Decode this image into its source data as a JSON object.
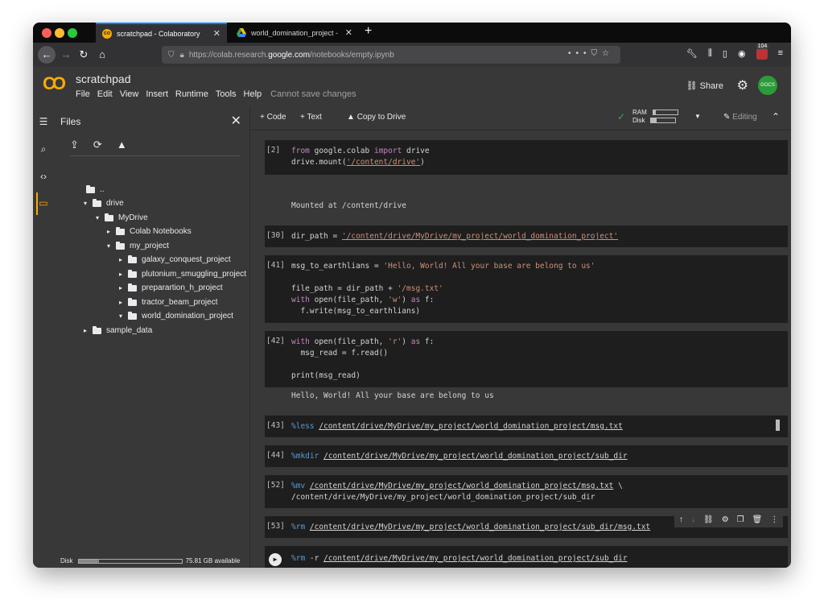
{
  "browser": {
    "tabs": [
      {
        "label": "scratchpad - Colaboratory",
        "active": true
      },
      {
        "label": "world_domination_project - Go",
        "active": false
      }
    ],
    "url_prefix": "https://colab.research.",
    "url_host": "google.com",
    "url_path": "/notebooks/empty.ipynb",
    "extension_badge": "104"
  },
  "header": {
    "logo": "CO",
    "title": "scratchpad",
    "menu": [
      "File",
      "Edit",
      "View",
      "Insert",
      "Runtime",
      "Tools",
      "Help"
    ],
    "note": "Cannot save changes",
    "share": "Share",
    "avatar": "GOCS"
  },
  "files_panel": {
    "title": "Files",
    "tree": [
      {
        "label": "..",
        "depth": 0,
        "type": "up"
      },
      {
        "label": "drive",
        "depth": 0,
        "type": "folder",
        "expanded": true
      },
      {
        "label": "MyDrive",
        "depth": 1,
        "type": "folder",
        "expanded": true
      },
      {
        "label": "Colab Notebooks",
        "depth": 2,
        "type": "folder",
        "expanded": false
      },
      {
        "label": "my_project",
        "depth": 2,
        "type": "folder",
        "expanded": true
      },
      {
        "label": "galaxy_conquest_project",
        "depth": 3,
        "type": "folder",
        "expanded": false
      },
      {
        "label": "plutonium_smuggling_project",
        "depth": 3,
        "type": "folder",
        "expanded": false
      },
      {
        "label": "preparartion_h_project",
        "depth": 3,
        "type": "folder",
        "expanded": false
      },
      {
        "label": "tractor_beam_project",
        "depth": 3,
        "type": "folder",
        "expanded": false
      },
      {
        "label": "world_domination_project",
        "depth": 3,
        "type": "folder",
        "expanded": true
      },
      {
        "label": "sample_data",
        "depth": 0,
        "type": "folder",
        "expanded": false,
        "top": true
      }
    ],
    "disk_label": "Disk",
    "disk_available": "75.81 GB available",
    "disk_used_fraction": 0.2
  },
  "toolbar": {
    "code": "Code",
    "text": "Text",
    "copy_to_drive": "Copy to Drive",
    "ram": "RAM",
    "disk": "Disk",
    "ram_fraction": 0.1,
    "disk_fraction": 0.25,
    "editing": "Editing"
  },
  "cells": [
    {
      "prompt": "[2]",
      "output": "Mounted at /content/drive"
    },
    {
      "prompt": "[30]"
    },
    {
      "prompt": "[41]"
    },
    {
      "prompt": "[42]",
      "output": "Hello, World! All your base are belong to us"
    },
    {
      "prompt": "[43]"
    },
    {
      "prompt": "[44]"
    },
    {
      "prompt": "[52]"
    },
    {
      "prompt": "[53]"
    },
    {
      "prompt": ""
    }
  ],
  "code_text": {
    "c2_l1_a": "from",
    "c2_l1_b": " google.colab ",
    "c2_l1_c": "import",
    "c2_l1_d": " drive",
    "c2_l2_a": "drive.mount(",
    "c2_l2_b": "'/content/drive'",
    "c2_l2_c": ")",
    "c30_a": "dir_path = ",
    "c30_b": "'/content/drive/MyDrive/my_project/world_domination_project'",
    "c41_l1_a": "msg_to_earthlians = ",
    "c41_l1_b": "'Hello, World! All your base are belong to us'",
    "c41_l3_a": "file_path = dir_path + ",
    "c41_l3_b": "'/msg.txt'",
    "c41_l4_a": "with",
    "c41_l4_b": " open(file_path, ",
    "c41_l4_c": "'w'",
    "c41_l4_d": ") ",
    "c41_l4_e": "as",
    "c41_l4_f": " f:",
    "c41_l5": "  f.write(msg_to_earthlians)",
    "c42_l1_a": "with",
    "c42_l1_b": " open(file_path, ",
    "c42_l1_c": "'r'",
    "c42_l1_d": ") ",
    "c42_l1_e": "as",
    "c42_l1_f": " f:",
    "c42_l2": "  msg_read = f.read()",
    "c42_l4": "print(msg_read)",
    "c43_a": "%less",
    "c43_b": "/content/drive/MyDrive/my_project/world_domination_project/msg.txt",
    "c44_a": "%mkdir",
    "c44_b": "/content/drive/MyDrive/my_project/world_domination_project/sub_dir",
    "c52_a": "%mv",
    "c52_b": "/content/drive/MyDrive/my_project/world_domination_project/msg.txt",
    "c52_c": " \\",
    "c52_l2": "/content/drive/MyDrive/my_project/world_domination_project/sub_dir",
    "c53_a": "%rm",
    "c53_b": "/content/drive/MyDrive/my_project/world_domination_project/sub_dir/msg.txt",
    "c_last_a": "%rm",
    "c_last_b": " -r ",
    "c_last_c": "/content/drive/MyDrive/my_project/world_domination_project/sub_dir"
  },
  "colors": {
    "keyword": "#c586c0",
    "string": "#ce9178",
    "magic": "#569cd6",
    "cell_bg": "#1e1e1e",
    "panel_bg": "#383838",
    "logo": "#f9ab00",
    "tab_accent": "#0a84ff"
  },
  "icons": {
    "rail": [
      "menu-icon",
      "search-icon",
      "code-icon",
      "folder-icon"
    ],
    "file_tools": [
      "upload-icon",
      "refresh-icon",
      "mount-drive-icon"
    ],
    "cell_tools": [
      "move-up-icon",
      "move-down-icon",
      "link-icon",
      "gear-icon",
      "mirror-icon",
      "delete-icon",
      "more-icon"
    ]
  }
}
